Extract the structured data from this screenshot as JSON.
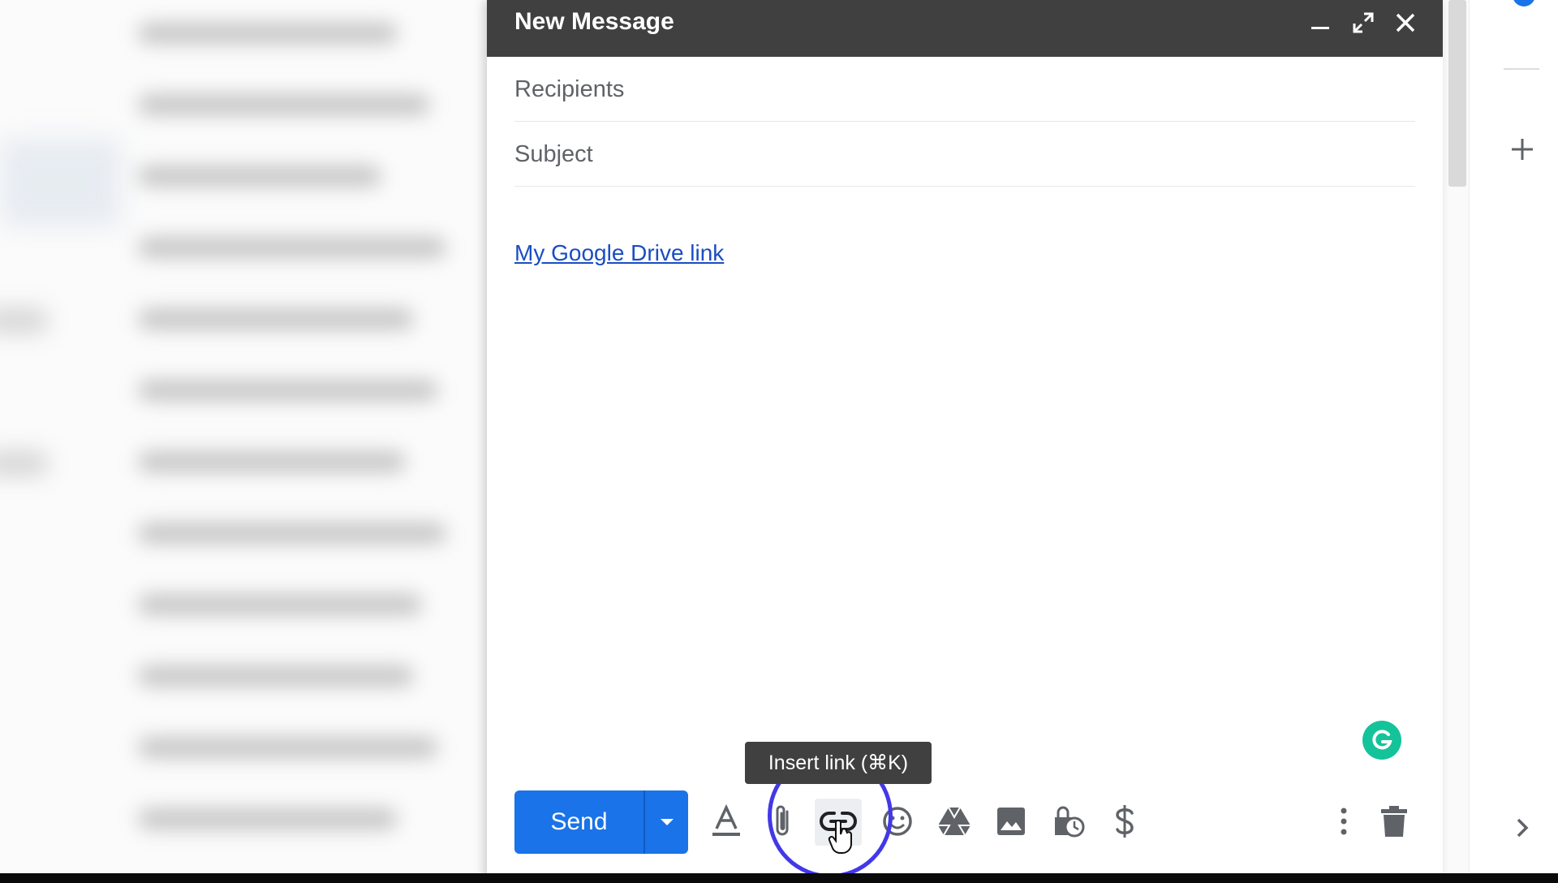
{
  "compose": {
    "title": "New Message",
    "recipients_placeholder": "Recipients",
    "subject_placeholder": "Subject",
    "body_link_text": "My Google Drive link",
    "header_buttons": [
      "minimize-icon",
      "expand-icon",
      "close-icon"
    ]
  },
  "toolbar": {
    "send_label": "Send",
    "tooltip_text": "Insert link (⌘K)",
    "tools": [
      "formatting-options-icon",
      "attach-file-icon",
      "insert-link-icon",
      "insert-emoji-icon",
      "google-drive-icon",
      "insert-photo-icon",
      "confidential-mode-icon",
      "send-money-icon",
      "more-options-icon",
      "discard-draft-icon"
    ]
  },
  "colors": {
    "header_bg": "#404040",
    "send_blue": "#1a73e8",
    "link_blue": "#1a4dc2",
    "grammarly_green": "#15c39a",
    "focus_ring": "#4338e8"
  }
}
